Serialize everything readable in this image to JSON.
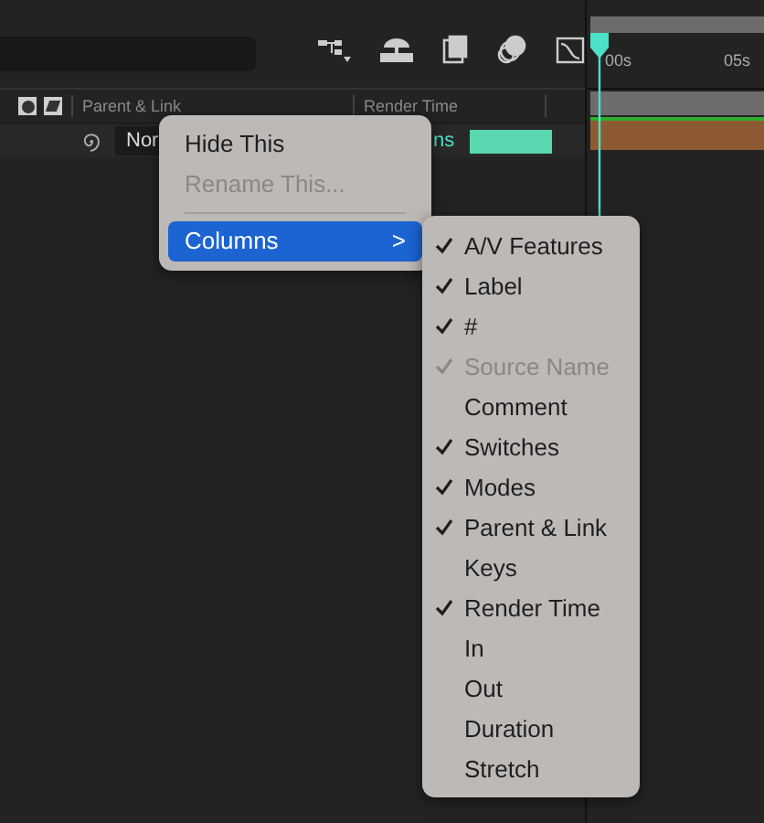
{
  "timeline": {
    "ruler_labels": [
      "00s",
      "05s"
    ]
  },
  "columns": [
    "Parent & Link",
    "Render Time"
  ],
  "layer": {
    "parent": "Nor",
    "render_time": "ns"
  },
  "context_menu": {
    "items": [
      {
        "kind": "item",
        "label": "Hide This",
        "disabled": false,
        "selected": false
      },
      {
        "kind": "item",
        "label": "Rename This...",
        "disabled": true,
        "selected": false
      },
      {
        "kind": "separator"
      },
      {
        "kind": "submenu",
        "label": "Columns",
        "arrow": ">",
        "disabled": false,
        "selected": true
      }
    ]
  },
  "columns_submenu": {
    "items": [
      {
        "label": "A/V Features",
        "checked": true,
        "disabled": false
      },
      {
        "label": "Label",
        "checked": true,
        "disabled": false
      },
      {
        "label": "#",
        "checked": true,
        "disabled": false
      },
      {
        "label": "Source Name",
        "checked": true,
        "disabled": true
      },
      {
        "label": "Comment",
        "checked": false,
        "disabled": false
      },
      {
        "label": "Switches",
        "checked": true,
        "disabled": false
      },
      {
        "label": "Modes",
        "checked": true,
        "disabled": false
      },
      {
        "label": "Parent & Link",
        "checked": true,
        "disabled": false
      },
      {
        "label": "Keys",
        "checked": false,
        "disabled": false
      },
      {
        "label": "Render Time",
        "checked": true,
        "disabled": false
      },
      {
        "label": "In",
        "checked": false,
        "disabled": false
      },
      {
        "label": "Out",
        "checked": false,
        "disabled": false
      },
      {
        "label": "Duration",
        "checked": false,
        "disabled": false
      },
      {
        "label": "Stretch",
        "checked": false,
        "disabled": false
      }
    ]
  }
}
